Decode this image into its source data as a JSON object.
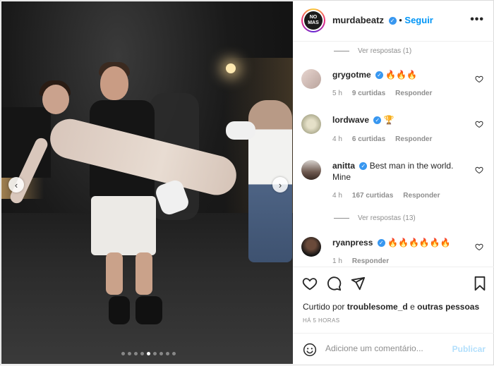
{
  "header": {
    "username": "murdabeatz",
    "separator": "•",
    "follow_label": "Seguir",
    "avatar_text": "NO MAS",
    "more_label": "•••"
  },
  "comments": {
    "replies_top": "Ver respostas (1)",
    "items": [
      {
        "user": "grygotme",
        "text": "🔥🔥🔥",
        "time": "5 h",
        "likes": "9 curtidas",
        "reply": "Responder"
      },
      {
        "user": "lordwave",
        "text": "🏆",
        "time": "4 h",
        "likes": "6 curtidas",
        "reply": "Responder"
      },
      {
        "user": "anitta",
        "text": "Best man in the world. Mine",
        "time": "4 h",
        "likes": "167 curtidas",
        "reply": "Responder"
      },
      {
        "user": "ryanpress",
        "text": "🔥🔥🔥🔥🔥🔥",
        "time": "1 h",
        "likes": "",
        "reply": "Responder"
      }
    ],
    "replies_mid": "Ver respostas (13)"
  },
  "actions": {
    "liked_prefix": "Curtido por",
    "liked_user": "troublesome_d",
    "liked_conj": "e",
    "liked_others": "outras pessoas",
    "time_ago": "HÁ 5 HORAS"
  },
  "add_comment": {
    "placeholder": "Adicione um comentário...",
    "publish_label": "Publicar"
  },
  "carousel": {
    "total": 9,
    "active_index": 4,
    "prev_label": "‹",
    "next_label": "›"
  },
  "colors": {
    "accent": "#0095f6",
    "verified": "#3897f0",
    "muted": "#8e8e8e",
    "publish_disabled": "#b2dffc"
  }
}
